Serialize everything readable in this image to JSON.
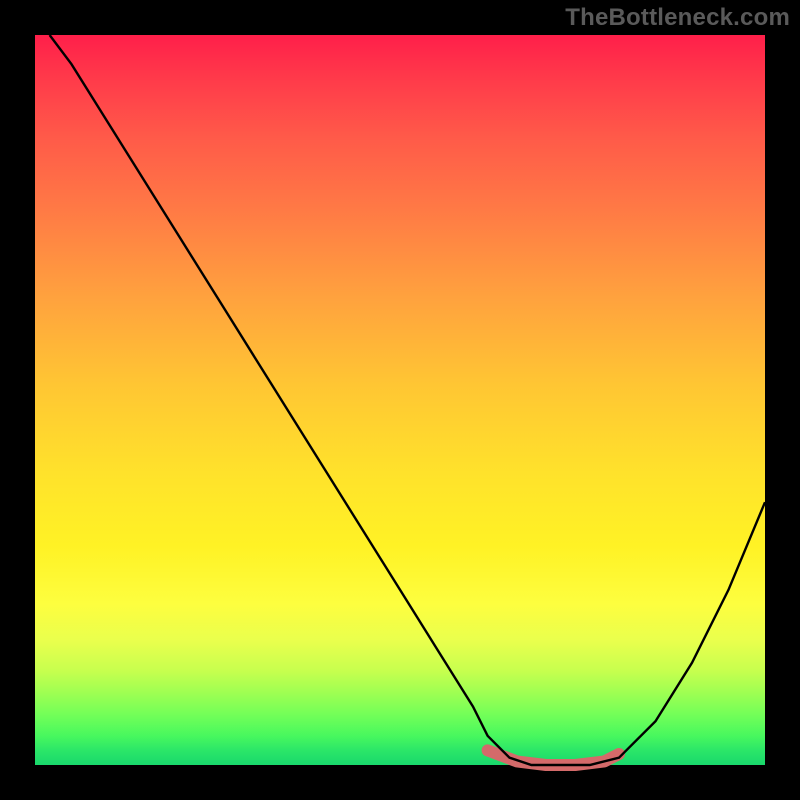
{
  "watermark": "TheBottleneck.com",
  "chart_data": {
    "type": "line",
    "title": "",
    "xlabel": "",
    "ylabel": "",
    "xlim": [
      0,
      100
    ],
    "ylim": [
      0,
      100
    ],
    "grid": false,
    "legend": false,
    "series": [
      {
        "name": "bottleneck-curve",
        "x": [
          2,
          5,
          10,
          15,
          20,
          25,
          30,
          35,
          40,
          45,
          50,
          55,
          60,
          62,
          65,
          68,
          72,
          76,
          80,
          85,
          90,
          95,
          100
        ],
        "y": [
          100,
          96,
          88,
          80,
          72,
          64,
          56,
          48,
          40,
          32,
          24,
          16,
          8,
          4,
          1,
          0,
          0,
          0,
          1,
          6,
          14,
          24,
          36
        ]
      },
      {
        "name": "optimal-range-highlight",
        "x": [
          62,
          66,
          70,
          74,
          78,
          80
        ],
        "y": [
          2,
          0.5,
          0,
          0,
          0.5,
          1.5
        ]
      }
    ],
    "background_gradient_stops": [
      {
        "pos": 0.0,
        "color": "#ff1f4a"
      },
      {
        "pos": 0.14,
        "color": "#ff5a49"
      },
      {
        "pos": 0.36,
        "color": "#ffa23e"
      },
      {
        "pos": 0.6,
        "color": "#ffe22b"
      },
      {
        "pos": 0.78,
        "color": "#fdfe3f"
      },
      {
        "pos": 0.9,
        "color": "#a0ff52"
      },
      {
        "pos": 1.0,
        "color": "#19d86c"
      }
    ]
  }
}
